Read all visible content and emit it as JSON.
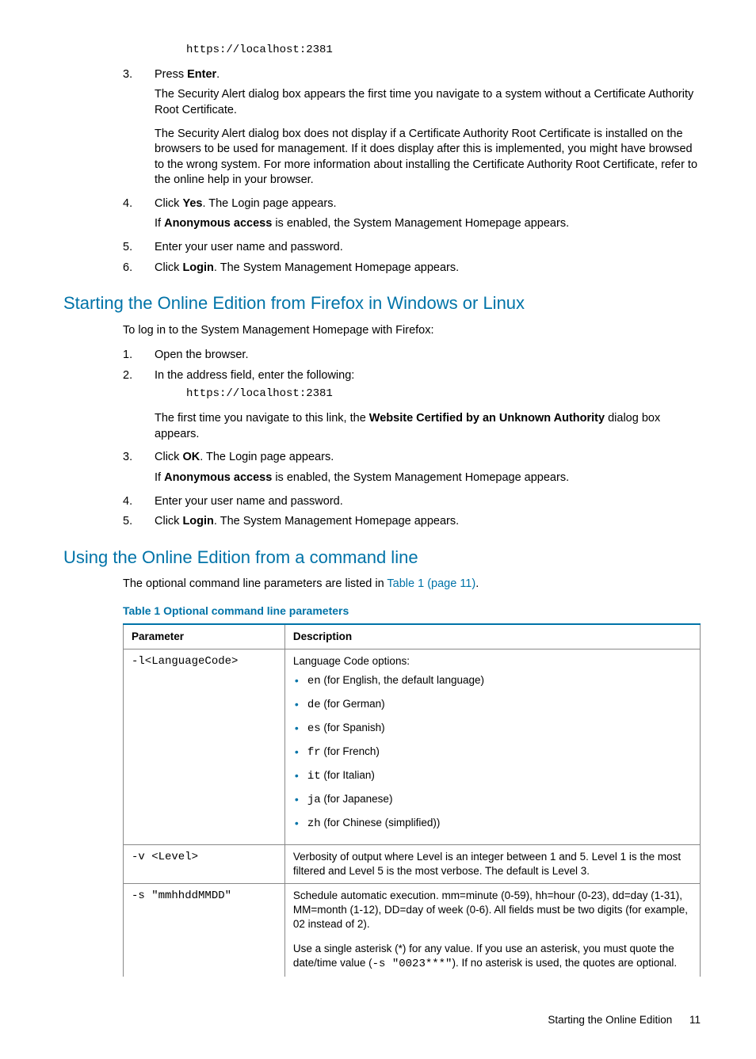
{
  "topCode": "https://localhost:2381",
  "sec1": {
    "li3": {
      "num": "3.",
      "a": "Press ",
      "b": "Enter",
      "c": ".",
      "p1": "The Security Alert dialog box appears the first time you navigate to a system without a Certificate Authority Root Certificate.",
      "p2": "The Security Alert dialog box does not display if a Certificate Authority Root Certificate is installed on the browsers to be used for management. If it does display after this is implemented, you might have browsed to the wrong system. For more information about installing the Certificate Authority Root Certificate, refer to the online help in your browser."
    },
    "li4": {
      "num": "4.",
      "a": "Click ",
      "b": "Yes",
      "c": ". The Login page appears.",
      "p1a": "If ",
      "p1b": "Anonymous access",
      "p1c": " is enabled, the System Management Homepage appears."
    },
    "li5": {
      "num": "5.",
      "t": "Enter your user name and password."
    },
    "li6": {
      "num": "6.",
      "a": "Click ",
      "b": "Login",
      "c": ". The System Management Homepage appears."
    }
  },
  "h2a": "Starting the Online Edition from Firefox in Windows or Linux",
  "sec2": {
    "intro": "To log in to the System Management Homepage with Firefox:",
    "li1": {
      "num": "1.",
      "t": "Open the browser."
    },
    "li2": {
      "num": "2.",
      "t": "In the address field, enter the following:",
      "code": "https://localhost:2381",
      "p1a": "The first time you navigate to this link, the ",
      "p1b": "Website Certified by an Unknown Authority",
      "p1c": " dialog box appears."
    },
    "li3": {
      "num": "3.",
      "a": "Click ",
      "b": "OK",
      "c": ". The Login page appears.",
      "p1a": "If ",
      "p1b": "Anonymous access",
      "p1c": " is enabled, the System Management Homepage appears."
    },
    "li4": {
      "num": "4.",
      "t": "Enter your user name and password."
    },
    "li5": {
      "num": "5.",
      "a": "Click ",
      "b": "Login",
      "c": ". The System Management Homepage appears."
    }
  },
  "h2b": "Using the Online Edition from a command line",
  "sec3": {
    "introA": "The optional command line parameters are listed in ",
    "introLink": "Table 1 (page 11)",
    "introB": ".",
    "caption": "Table 1 Optional command line parameters",
    "thParam": "Parameter",
    "thDesc": "Description",
    "r1": {
      "param": "-l<LanguageCode>",
      "lead": "Language Code options:",
      "opts": [
        {
          "code": "en",
          "txt": " (for English, the default language)"
        },
        {
          "code": "de",
          "txt": " (for German)"
        },
        {
          "code": "es",
          "txt": " (for Spanish)"
        },
        {
          "code": "fr",
          "txt": " (for French)"
        },
        {
          "code": "it",
          "txt": " (for Italian)"
        },
        {
          "code": "ja",
          "txt": " (for Japanese)"
        },
        {
          "code": "zh",
          "txt": " (for Chinese (simplified))"
        }
      ]
    },
    "r2": {
      "param": "-v <Level>",
      "desc": "Verbosity of output where Level is an integer between 1 and 5. Level 1 is the most filtered and Level 5 is the most verbose. The default is Level 3."
    },
    "r3": {
      "param": "-s \"mmhhddMMDD\"",
      "p1": "Schedule automatic execution. mm=minute (0-59), hh=hour (0-23), dd=day (1-31), MM=month (1-12), DD=day of week (0-6). All fields must be two digits (for example, 02 instead of 2).",
      "p2a": "Use a single asterisk (*) for any value. If you use an asterisk, you must quote the date/time value (",
      "p2code": "-s \"0023***\"",
      "p2b": "). If no asterisk is used, the quotes are optional."
    }
  },
  "footer": {
    "title": "Starting the Online Edition",
    "page": "11"
  }
}
